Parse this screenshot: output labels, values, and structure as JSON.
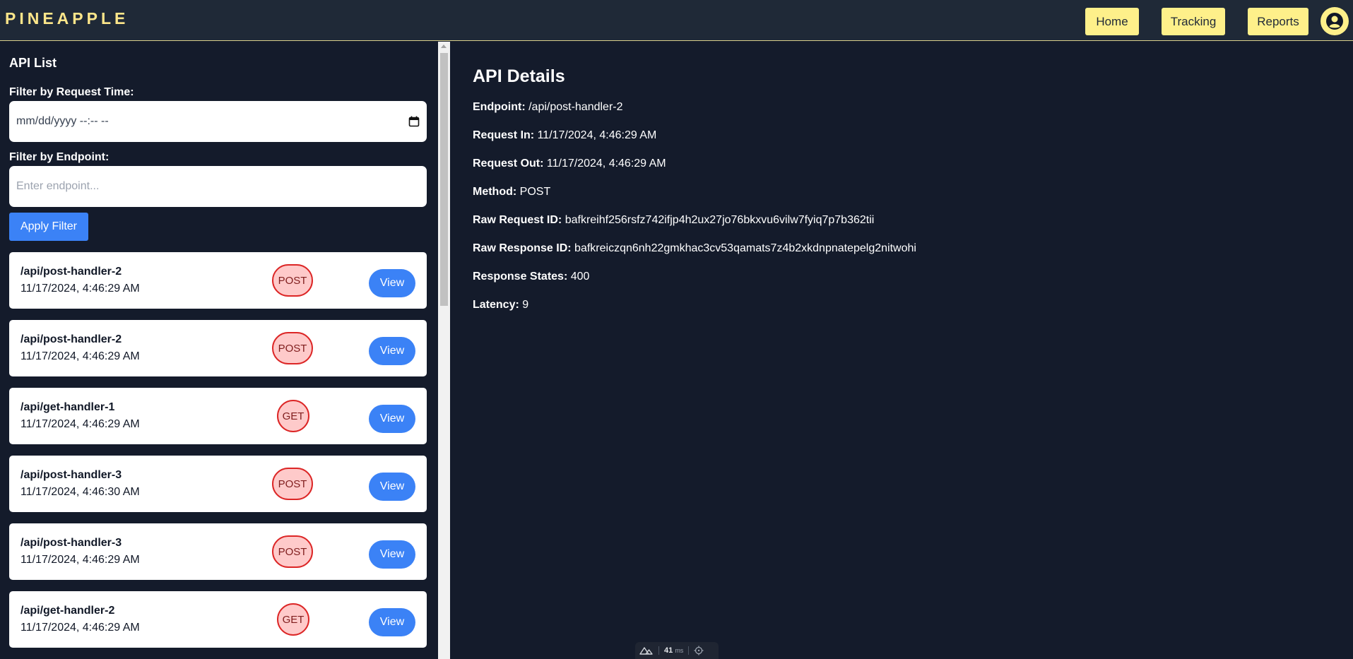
{
  "header": {
    "logo": "PINEAPPLE",
    "nav": [
      "Home",
      "Tracking",
      "Reports"
    ],
    "accent": "#fef08a"
  },
  "sidebar": {
    "title": "API List",
    "filter_time_label": "Filter by Request Time:",
    "filter_time_value": "mm/dd/yyyy --:-- --",
    "filter_endpoint_label": "Filter by Endpoint:",
    "filter_endpoint_placeholder": "Enter endpoint...",
    "apply_label": "Apply Filter",
    "items": [
      {
        "endpoint": "/api/post-handler-2",
        "time": "11/17/2024, 4:46:29 AM",
        "method": "POST",
        "action": "View"
      },
      {
        "endpoint": "/api/post-handler-2",
        "time": "11/17/2024, 4:46:29 AM",
        "method": "POST",
        "action": "View"
      },
      {
        "endpoint": "/api/get-handler-1",
        "time": "11/17/2024, 4:46:29 AM",
        "method": "GET",
        "action": "View"
      },
      {
        "endpoint": "/api/post-handler-3",
        "time": "11/17/2024, 4:46:30 AM",
        "method": "POST",
        "action": "View"
      },
      {
        "endpoint": "/api/post-handler-3",
        "time": "11/17/2024, 4:46:29 AM",
        "method": "POST",
        "action": "View"
      },
      {
        "endpoint": "/api/get-handler-2",
        "time": "11/17/2024, 4:46:29 AM",
        "method": "GET",
        "action": "View"
      }
    ]
  },
  "details": {
    "title": "API Details",
    "rows": [
      {
        "key": "Endpoint:",
        "value": "/api/post-handler-2"
      },
      {
        "key": "Request In:",
        "value": "11/17/2024, 4:46:29 AM"
      },
      {
        "key": "Request Out:",
        "value": "11/17/2024, 4:46:29 AM"
      },
      {
        "key": "Method:",
        "value": "POST"
      },
      {
        "key": "Raw Request ID:",
        "value": "bafkreihf256rsfz742ifjp4h2ux27jo76bkxvu6vilw7fyiq7p7b362tii"
      },
      {
        "key": "Raw Response ID:",
        "value": "bafkreiczqn6nh22gmkhac3cv53qamats7z4b2xkdnpnatepelg2nitwohi"
      },
      {
        "key": "Response States:",
        "value": "400"
      },
      {
        "key": "Latency:",
        "value": "9"
      }
    ]
  },
  "devbar": {
    "value": "41",
    "unit": "ms"
  }
}
